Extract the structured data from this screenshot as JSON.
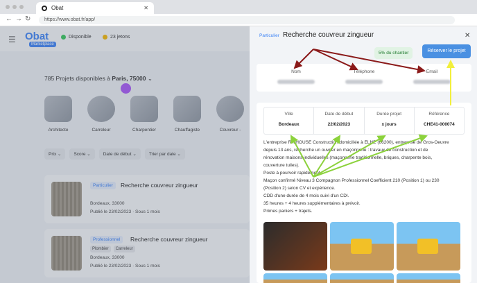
{
  "browser": {
    "tab_title": "Obat",
    "url": "https://www.obat.fr/app/"
  },
  "header": {
    "logo": "Obat",
    "logo_sub": "Marketplace",
    "status": "Disponible",
    "tokens": "23 jetons"
  },
  "list": {
    "count_text": "785 Projets disponibles à",
    "city": "Paris, 75000",
    "categories": [
      {
        "label": "Architecte"
      },
      {
        "label": "Carreleur"
      },
      {
        "label": "Charpentier"
      },
      {
        "label": "Chauffagiste"
      },
      {
        "label": "Couvreur -"
      }
    ],
    "filters": [
      "Prix",
      "Score",
      "Date de début",
      "Trier par date"
    ],
    "cards": [
      {
        "badge": "Particulier",
        "title": "Recherche couvreur zingueur",
        "tags": [],
        "location": "Bordeaux, 33000",
        "published": "Publié le 23/02/2023 · Sous 1 mois"
      },
      {
        "badge": "Professionnel",
        "title": "Recherche couvreur zingueur",
        "tags": [
          "Plombier",
          "Carreleur"
        ],
        "location": "Bordeaux, 33000",
        "published": "Publié le 23/02/2023 · Sous 1 mois"
      }
    ]
  },
  "panel": {
    "badge": "Particulier",
    "title": "Recherche couvreur zingueur",
    "percent": "5% du chantier",
    "reserve": "Réserver le projet",
    "contact": {
      "name_label": "Nom",
      "phone_label": "Téléphone",
      "email_label": "Email"
    },
    "props": [
      {
        "k": "Ville",
        "v": "Bordeaux"
      },
      {
        "k": "Date de début",
        "v": "22/02/2023"
      },
      {
        "k": "Durée projet",
        "v": "x jours"
      },
      {
        "k": "Référence",
        "v": "CHE41-000074"
      }
    ],
    "description": [
      "L'entreprise RH'HOUSE Construction domiciliée à ELNE (66200), entreprise de Gros-Oeuvre",
      "depuis 13 ans, recherche un ouvrier en maçonnerie : travaux de construction et de",
      "rénovation maisons individuelles (maçonnerie traditionnelle, briques, charpente bois,",
      "couverture tuiles).",
      "Poste à pourvoir rapidement !",
      "Maçon confirmé Niveau 3 Compagnon Professionnel Coefficient 210 (Position 1) ou 230",
      "(Position 2) selon CV et expérience.",
      "CDD d'une durée de 4 mois suivi d'un CDI.",
      "35 heures + 4 heures supplémentaires à prévoir.",
      "Primes paniers + trajets."
    ]
  },
  "colors": {
    "accent": "#4a90e2",
    "arrow_red": "#8b1a1a",
    "arrow_green": "#8cd23c",
    "arrow_yellow": "#f2ef3c"
  }
}
